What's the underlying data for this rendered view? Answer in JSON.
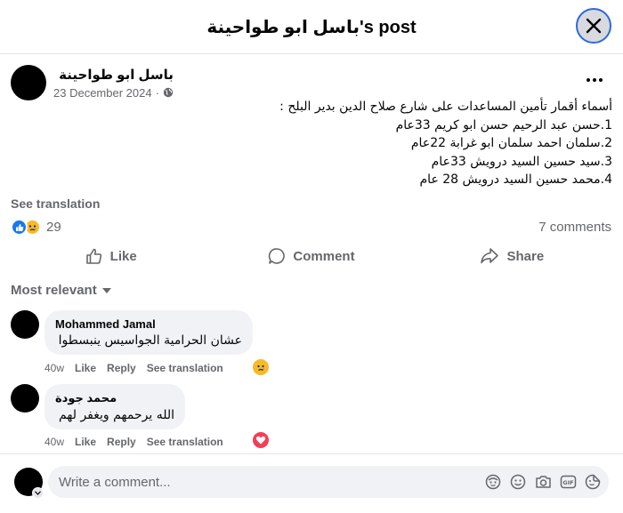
{
  "header": {
    "title": "باسل ابو طواحينة's post"
  },
  "post": {
    "author": "باسل ابو طواحينة",
    "date": "23 December 2024",
    "visibility_icon": "globe-icon",
    "body_lines": [
      "أسماء أقمار تأمين المساعدات على شارع صلاح الدين بدير البلح :",
      "1.حسن عبد الرحيم حسن ابو كريم 33عام",
      "2.سلمان احمد سلمان ابو غرابة 22عام",
      "3.سيد حسين السيد درويش 33عام",
      "4.محمد حسين السيد درويش 28 عام"
    ],
    "see_translation": "See translation",
    "reaction_count": "29",
    "comments_count": "7 comments"
  },
  "actions": {
    "like": "Like",
    "comment": "Comment",
    "share": "Share"
  },
  "filter": {
    "label": "Most relevant"
  },
  "comments": [
    {
      "name": "Mohammed Jamal",
      "text": "عشان الحرامية الجواسيس ينبسطوا",
      "age": "40w",
      "like": "Like",
      "reply": "Reply",
      "translate": "See translation",
      "reaction": "sad-icon"
    },
    {
      "name": "محمد جودة",
      "text": "الله يرحمهم ويغفر لهم",
      "age": "40w",
      "like": "Like",
      "reply": "Reply",
      "translate": "See translation",
      "reaction": "love-icon"
    }
  ],
  "composer": {
    "placeholder": "Write a comment..."
  },
  "colors": {
    "brand_blue": "#1877f2",
    "secondary_text": "#65676b",
    "bubble_bg": "#f0f2f5",
    "love_red": "#f33e58",
    "sad_yellow": "#f7b928"
  }
}
